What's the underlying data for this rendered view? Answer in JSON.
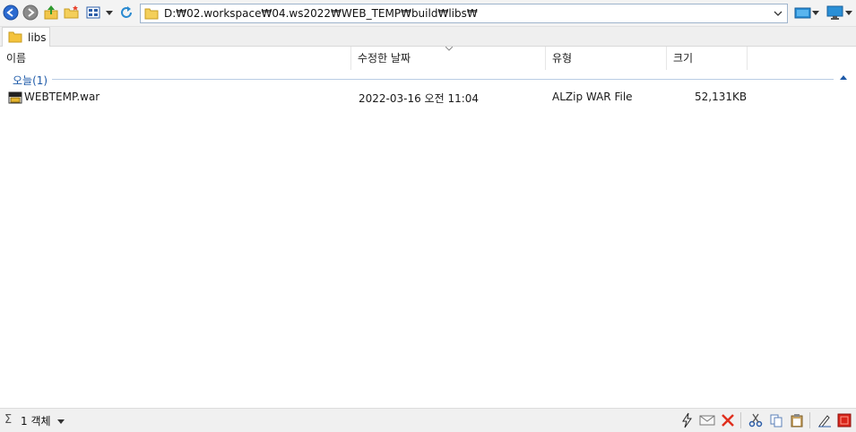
{
  "toolbar": {
    "back_icon": "back-arrow-icon",
    "forward_icon": "forward-arrow-icon",
    "up_icon": "folder-up-icon",
    "new_folder_icon": "new-folder-icon",
    "view_icon": "view-mode-icon",
    "refresh_icon": "refresh-icon",
    "address": "D:₩02.workspace₩04.ws2022₩WEB_TEMP₩build₩libs₩"
  },
  "tabs": [
    {
      "label": "libs"
    }
  ],
  "columns": {
    "name": "이름",
    "modified": "수정한 날짜",
    "type": "유형",
    "size": "크기"
  },
  "group": {
    "label": "오늘(1)"
  },
  "files": [
    {
      "name": "WEBTEMP.war",
      "modified": "2022-03-16 오전 11:04",
      "type": "ALZip WAR File",
      "size": "52,131KB"
    }
  ],
  "status": {
    "sigma": "Σ",
    "count": "1 객체"
  },
  "colors": {
    "accent": "#1e5aa8",
    "delete": "#e0301e"
  }
}
